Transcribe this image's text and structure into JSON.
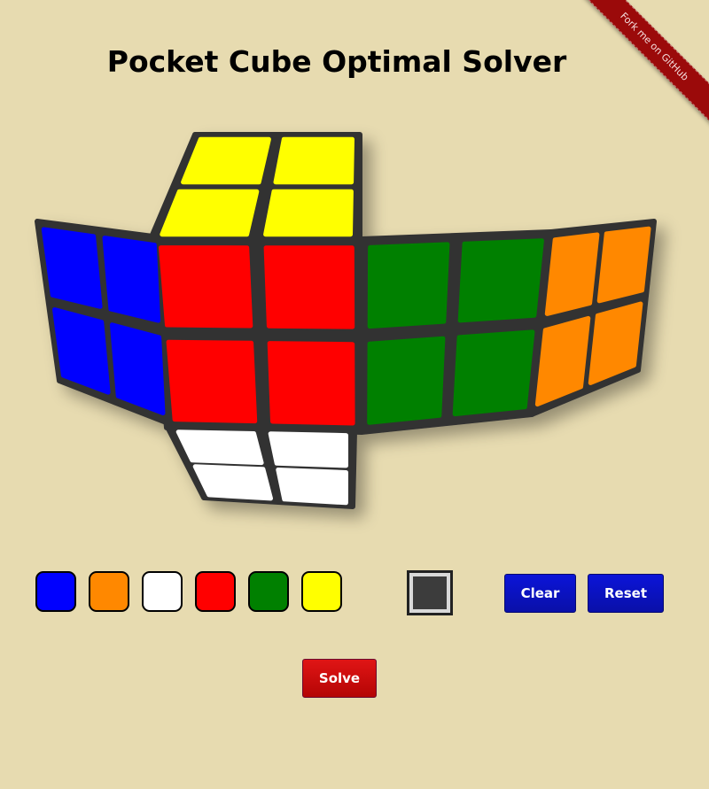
{
  "title": "Pocket Cube Optimal Solver",
  "ribbon": "Fork me on GitHub",
  "colors": {
    "blue": "#0000ff",
    "orange": "#ff8800",
    "white": "#ffffff",
    "red": "#ff0000",
    "green": "#008000",
    "yellow": "#ffff00",
    "cube_body": "#333333"
  },
  "faces": {
    "up": [
      "yellow",
      "yellow",
      "yellow",
      "yellow"
    ],
    "left": [
      "blue",
      "blue",
      "blue",
      "blue"
    ],
    "front": [
      "red",
      "red",
      "red",
      "red"
    ],
    "right": [
      "green",
      "green",
      "green",
      "green"
    ],
    "back": [
      "orange",
      "orange",
      "orange",
      "orange"
    ],
    "down": [
      "white",
      "white",
      "white",
      "white"
    ]
  },
  "palette": [
    "blue",
    "orange",
    "white",
    "red",
    "green",
    "yellow"
  ],
  "selected_color": "dark-gray",
  "buttons": {
    "clear": "Clear",
    "reset": "Reset",
    "solve": "Solve"
  }
}
